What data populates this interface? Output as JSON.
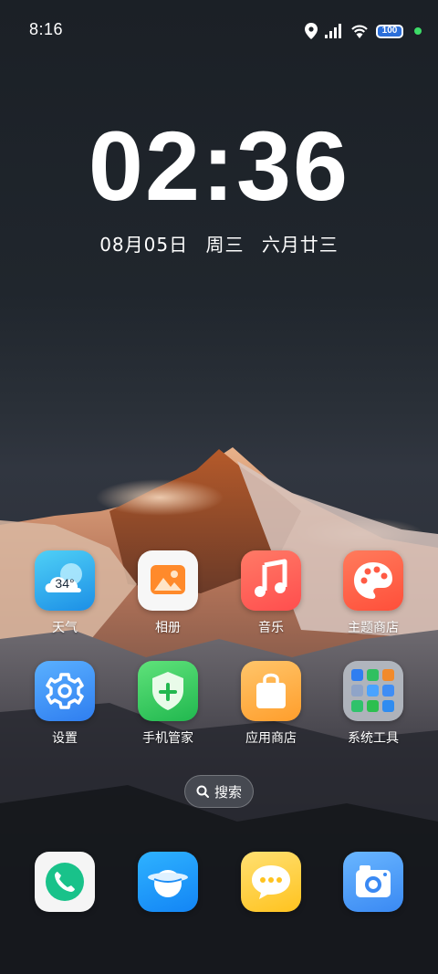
{
  "status_bar": {
    "time": "8:16",
    "battery_level": "100",
    "icons": [
      "location-icon",
      "signal-icon",
      "wifi-icon",
      "battery-icon",
      "charging-dot-icon"
    ],
    "charging_dot_color": "#3ddc68"
  },
  "clock": {
    "time": "02:36",
    "date": "08月05日",
    "weekday": "周三",
    "lunar_date": "六月廿三"
  },
  "apps_row1": [
    {
      "label": "天气",
      "badge": "34°",
      "icon": "weather-icon"
    },
    {
      "label": "相册",
      "icon": "gallery-icon"
    },
    {
      "label": "音乐",
      "icon": "music-icon"
    },
    {
      "label": "主题商店",
      "icon": "palette-icon"
    }
  ],
  "apps_row2": [
    {
      "label": "设置",
      "icon": "gear-icon"
    },
    {
      "label": "手机管家",
      "icon": "shield-plus-icon"
    },
    {
      "label": "应用商店",
      "icon": "shopping-bag-icon"
    },
    {
      "label": "系统工具",
      "icon": "folder-icon"
    }
  ],
  "search": {
    "label": "搜索",
    "icon": "search-icon"
  },
  "dock": [
    {
      "name": "phone",
      "icon": "phone-icon"
    },
    {
      "name": "browser",
      "icon": "planet-icon"
    },
    {
      "name": "messages",
      "icon": "chat-bubble-icon"
    },
    {
      "name": "camera",
      "icon": "camera-icon"
    }
  ]
}
